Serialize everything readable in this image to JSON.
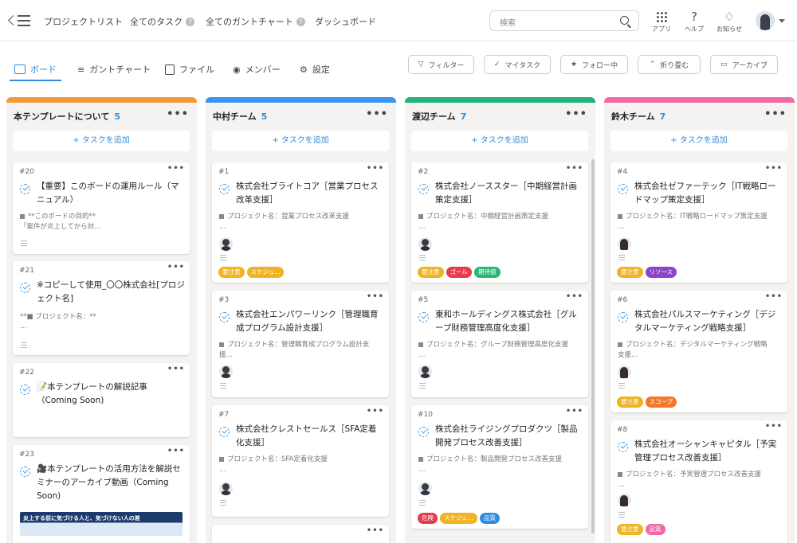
{
  "nav": {
    "items": [
      "プロジェクトリスト",
      "全てのタスク",
      "全てのガントチャート",
      "ダッシュボード"
    ],
    "help_mark": "?"
  },
  "search": {
    "placeholder": "検索"
  },
  "top_icons": {
    "apps": "アプリ",
    "help": "ヘルプ",
    "notify": "お知らせ"
  },
  "tabs": [
    "ボード",
    "ガントチャート",
    "ファイル",
    "メンバー",
    "設定"
  ],
  "filters": [
    "フィルター",
    "マイタスク",
    "フォロー中",
    "折り畳む",
    "アーカイブ"
  ],
  "add_task": "+ タスクを追加",
  "more": "•••",
  "columns": [
    {
      "name": "本テンプレートについて",
      "count": "5",
      "color": "#f59a3c",
      "cards": [
        {
          "num": "#20",
          "title": "【重要】このボードの運用ルール（マニュアル）",
          "proj": "**このボードの目的**",
          "proj2": "「案件が炎上してから対…"
        },
        {
          "num": "#21",
          "title": "※コピーして使用_〇〇株式会社[プロジェクト名]",
          "proj": "**■ プロジェクト名：**",
          "proj2": "…"
        },
        {
          "num": "#22",
          "title": "📝本テンプレートの解説記事（Coming Soon)"
        },
        {
          "num": "#23",
          "title": "🎥本テンプレートの活用方法を解説セミナーのアーカイブ動画（Coming Soon)",
          "thumb": "炎上する前に気づける人と、気づけない人の差"
        }
      ]
    },
    {
      "name": "中村チーム",
      "count": "5",
      "color": "#3d94f0",
      "cards": [
        {
          "num": "#1",
          "title": "株式会社ブライトコア［営業プロセス改革支援］",
          "proj": "プロジェクト名：営業プロセス改革支援",
          "tags": [
            {
              "t": "要注意",
              "c": "#f0b323"
            },
            {
              "t": "スケジュ…",
              "c": "#f0b323"
            }
          ]
        },
        {
          "num": "#3",
          "title": "株式会社エンパワーリンク［管理職育成プログラム設計支援］",
          "proj": "プロジェクト名：管理職育成プログラム設計支",
          "proj2": "援…"
        },
        {
          "num": "#7",
          "title": "株式会社クレストセールス［SFA定着化支援］",
          "proj": "プロジェクト名：SFA定着化支援"
        }
      ]
    },
    {
      "name": "渡辺チーム",
      "count": "7",
      "color": "#24b27a",
      "cards": [
        {
          "num": "#2",
          "title": "株式会社ノーススター［中期経営計画策定支援］",
          "proj": "プロジェクト名：中期経営計画策定支援",
          "tags": [
            {
              "t": "要注意",
              "c": "#f0b323"
            },
            {
              "t": "ゴール",
              "c": "#e8394d"
            },
            {
              "t": "期待値",
              "c": "#2bb673"
            }
          ]
        },
        {
          "num": "#5",
          "title": "東和ホールディングス株式会社［グループ財務管理高度化支援］",
          "proj": "プロジェクト名：グループ財務管理高度化支援"
        },
        {
          "num": "#10",
          "title": "株式会社ライジングプロダクツ［製品開発プロセス改善支援］",
          "proj": "プロジェクト名：製品開発プロセス改善支援",
          "tags": [
            {
              "t": "危険",
              "c": "#e8394d"
            },
            {
              "t": "スケジュ…",
              "c": "#f0b323"
            },
            {
              "t": "品質",
              "c": "#2f8ee0"
            }
          ]
        }
      ]
    },
    {
      "name": "鈴木チーム",
      "count": "7",
      "color": "#f06aa7",
      "cards": [
        {
          "num": "#4",
          "title": "株式会社ゼファーテック［IT戦略ロードマップ策定支援］",
          "proj": "プロジェクト名：IT戦略ロードマップ策定支援",
          "tags": [
            {
              "t": "要注意",
              "c": "#f0b323"
            },
            {
              "t": "リソース",
              "c": "#8a45c9"
            }
          ]
        },
        {
          "num": "#6",
          "title": "株式会社パルスマーケティング［デジタルマーケティング戦略支援］",
          "proj": "プロジェクト名：デジタルマーケティング戦略",
          "proj2": "支援…",
          "tags": [
            {
              "t": "要注意",
              "c": "#f0b323"
            },
            {
              "t": "スコープ",
              "c": "#f07a2a"
            }
          ]
        },
        {
          "num": "#8",
          "title": "株式会社オーシャンキャピタル［予実管理プロセス改善支援］",
          "proj": "プロジェクト名：予実管理プロセス改善支援",
          "tags": [
            {
              "t": "要注意",
              "c": "#f0b323"
            },
            {
              "t": "品質",
              "c": "#f06aa7"
            }
          ]
        }
      ]
    }
  ]
}
